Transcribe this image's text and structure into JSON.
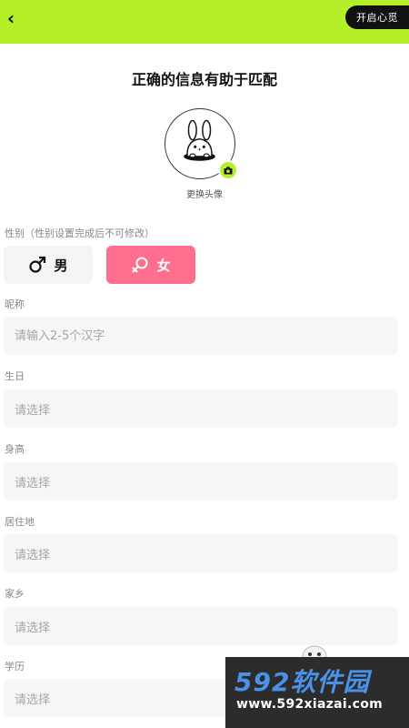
{
  "header": {
    "back_icon": "chevron-left-icon",
    "back_glyph": "‹",
    "open_button_label": "开启心觅"
  },
  "title": "正确的信息有助于匹配",
  "avatar": {
    "change_label": "更换头像",
    "camera_icon": "camera-icon"
  },
  "gender": {
    "label": "性别（性别设置完成后不可修改）",
    "options": [
      {
        "label": "男",
        "icon": "male-symbol-icon",
        "selected": false
      },
      {
        "label": "女",
        "icon": "female-symbol-icon",
        "selected": true
      }
    ]
  },
  "fields": [
    {
      "label": "昵称",
      "placeholder": "请输入2-5个汉字",
      "value": ""
    },
    {
      "label": "生日",
      "placeholder": "请选择"
    },
    {
      "label": "身高",
      "placeholder": "请选择"
    },
    {
      "label": "居住地",
      "placeholder": "请选择"
    },
    {
      "label": "家乡",
      "placeholder": "请选择"
    },
    {
      "label": "学历",
      "placeholder": "请选择"
    }
  ],
  "watermark": {
    "main": "592软件园",
    "url": "www.592xiazai.com"
  },
  "colors": {
    "accent": "#b4f02a",
    "female_selected": "#ff6e8f",
    "input_bg": "#f6f6f6",
    "watermark_blue": "#4a92e8"
  }
}
